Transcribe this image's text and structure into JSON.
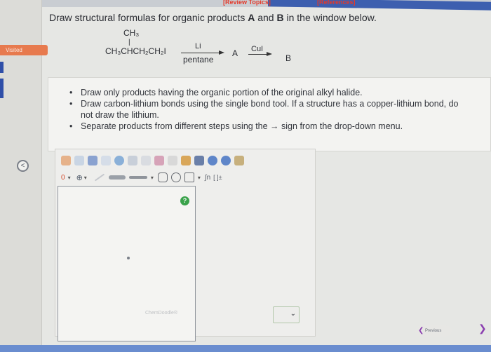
{
  "top": {
    "review_topics": "[Review Topics]",
    "references": "[References]"
  },
  "gutter": {
    "visited_label": "Visited",
    "nav_icon": "chevron-left-icon"
  },
  "question": {
    "prefix": "Draw structural formulas for organic products ",
    "a": "A",
    "and": " and ",
    "b": "B",
    "suffix": " in the window below."
  },
  "reaction": {
    "ch3": "CH₃",
    "reactant": "CH₃CHCH₂CH₂I",
    "reagent1_top": "Li",
    "reagent1_bottom": "pentane",
    "product_a": "A",
    "reagent2_top": "CuI",
    "product_b": "B"
  },
  "instructions": [
    "Draw only products having the organic portion of the original alkyl halide.",
    "Draw carbon-lithium bonds using the single bond tool. If a structure has a copper-lithium bond, do",
    "not draw the lithium.",
    "Separate products from different steps using the → sign from the drop-down menu."
  ],
  "editor": {
    "charge_label": "0",
    "help_label": "?",
    "watermark": "ChemDoodle®",
    "bracket_label": "[ ]±"
  },
  "footer": {
    "previous": "Previous"
  },
  "colors": {
    "accent_blue": "#3d5faf",
    "visited_orange": "#e77a4e",
    "link_red": "#e33a2a",
    "help_green": "#39a24a"
  }
}
